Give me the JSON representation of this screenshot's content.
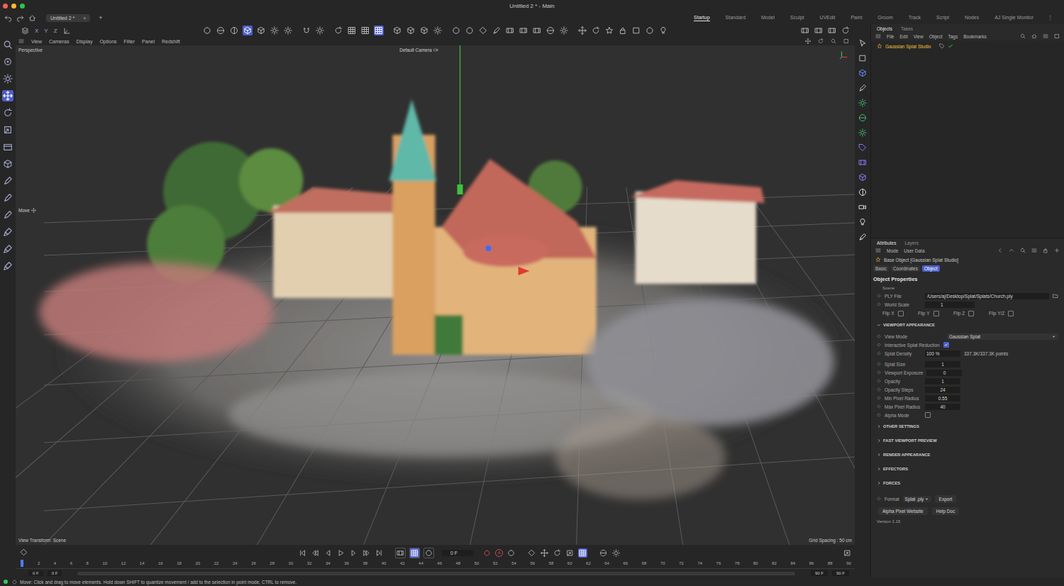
{
  "window": {
    "title": "Untitled 2 * - Main"
  },
  "document_tabs": [
    {
      "label": "Untitled 2 *",
      "selected": true,
      "close": "×"
    }
  ],
  "new_tab": "+",
  "layouts": [
    {
      "label": "Startup",
      "selected": true
    },
    {
      "label": "Standard",
      "selected": false
    },
    {
      "label": "Model",
      "selected": false
    },
    {
      "label": "Sculpt",
      "selected": false
    },
    {
      "label": "UVEdit",
      "selected": false
    },
    {
      "label": "Paint",
      "selected": false
    },
    {
      "label": "Groom",
      "selected": false
    },
    {
      "label": "Track",
      "selected": false
    },
    {
      "label": "Script",
      "selected": false
    },
    {
      "label": "Nodes",
      "selected": false
    },
    {
      "label": "AJ Single Monitor",
      "selected": false
    }
  ],
  "layouts_more": "⋮",
  "left_tools": [
    {
      "selected": false
    },
    {
      "selected": false
    },
    {
      "selected": false
    },
    {
      "selected": true
    },
    {
      "selected": false
    },
    {
      "selected": false
    },
    {
      "selected": false
    },
    {
      "selected": false
    },
    {
      "selected": false
    },
    {
      "selected": false
    },
    {
      "selected": false
    },
    {
      "selected": false
    },
    {
      "selected": false
    },
    {
      "selected": false
    }
  ],
  "viewport_toolbar": {
    "axis_locks": [
      "X",
      "Y",
      "Z"
    ],
    "groups": [
      [
        {
          "selected": false
        },
        {
          "selected": false
        },
        {
          "selected": false
        },
        {
          "selected": true
        },
        {
          "selected": false
        },
        {
          "selected": false
        },
        {
          "selected": false
        }
      ],
      [
        {
          "selected": false
        },
        {
          "selected": false
        }
      ],
      [
        {
          "selected": false
        },
        {
          "selected": false
        },
        {
          "selected": false
        },
        {
          "selected": true
        }
      ],
      [
        {
          "selected": false
        },
        {
          "selected": false
        },
        {
          "selected": false
        },
        {
          "selected": false
        }
      ],
      [
        {
          "selected": false
        },
        {
          "selected": false
        },
        {
          "selected": false
        },
        {
          "selected": false
        },
        {
          "selected": false
        },
        {
          "selected": false
        },
        {
          "selected": false
        },
        {
          "selected": false
        },
        {
          "selected": false
        }
      ],
      [
        {
          "selected": false
        },
        {
          "selected": false
        },
        {
          "selected": false
        },
        {
          "selected": false
        },
        {
          "selected": false
        },
        {
          "selected": false
        },
        {
          "selected": false
        }
      ]
    ],
    "right": [
      {
        "selected": false
      },
      {
        "selected": false
      },
      {
        "selected": false
      },
      {
        "selected": false
      }
    ]
  },
  "viewport": {
    "menu": [
      "View",
      "Cameras",
      "Display",
      "Options",
      "Filter",
      "Panel",
      "Redshift"
    ],
    "view_name": "Perspective",
    "camera": "Default Camera",
    "tool_hint": "Move",
    "view_transform": "View Transform: Scene",
    "grid_spacing": "Grid Spacing : 50 cm"
  },
  "timeline": {
    "current_frame": "0 F",
    "autokey": "A",
    "mode_buttons": [
      {
        "selected": false
      },
      {
        "selected": true
      },
      {
        "selected": false
      }
    ],
    "key_buttons": [
      {
        "selected": false
      },
      {
        "selected": false
      },
      {
        "selected": false
      },
      {
        "selected": false
      },
      {
        "selected": true
      }
    ],
    "ticks": [
      "0",
      "2",
      "4",
      "6",
      "8",
      "10",
      "12",
      "14",
      "16",
      "18",
      "20",
      "22",
      "24",
      "26",
      "28",
      "30",
      "32",
      "34",
      "36",
      "38",
      "40",
      "42",
      "44",
      "46",
      "48",
      "50",
      "52",
      "54",
      "56",
      "58",
      "60",
      "62",
      "64",
      "66",
      "68",
      "70",
      "72",
      "74",
      "76",
      "78",
      "80",
      "82",
      "84",
      "86",
      "88",
      "90"
    ],
    "playhead_level": 0,
    "range_start": "0 F",
    "preview_start": "0 F",
    "preview_end": "90 F",
    "range_end": "90 F"
  },
  "objects_manager": {
    "tabs": [
      {
        "label": "Objects",
        "selected": true
      },
      {
        "label": "Takes",
        "selected": false
      }
    ],
    "menu": [
      "File",
      "Edit",
      "View",
      "Object",
      "Tags",
      "Bookmarks"
    ],
    "items": [
      {
        "name": "Gaussian Splat Studio",
        "selected": true,
        "enabled": true
      }
    ]
  },
  "attributes": {
    "tabs": [
      {
        "label": "Attributes",
        "selected": true
      },
      {
        "label": "Layers",
        "selected": false
      }
    ],
    "menu": [
      "Mode",
      "User Data"
    ],
    "object_title": "Base Object [Gaussian Splat Studio]",
    "sub_tabs": [
      {
        "label": "Basic",
        "selected": false
      },
      {
        "label": "Coordinates",
        "selected": false
      },
      {
        "label": "Object",
        "selected": true
      }
    ],
    "heading": "Object Properties",
    "group": "Scene",
    "ply_file": {
      "label": "PLY File",
      "value": "/Users/aj/Desktop/Splat/Splats/Church.ply"
    },
    "world_scale": {
      "label": "World Scale",
      "value": "1"
    },
    "flips": [
      {
        "label": "Flip X",
        "checked": false
      },
      {
        "label": "Flip Y",
        "checked": false
      },
      {
        "label": "Flip Z",
        "checked": false
      },
      {
        "label": "Flip Y/Z",
        "checked": false
      }
    ],
    "sections": [
      {
        "title": "VIEWPORT APPEARANCE",
        "expanded": true,
        "rows": [
          {
            "kind": "dropdown",
            "label": "View Mode",
            "value": "Gaussian Splat"
          },
          {
            "kind": "checkbox",
            "label": "Interactive Splat Reduction",
            "checked": true
          },
          {
            "kind": "density",
            "label": "Splat Density",
            "value": "100 %",
            "note": "337.3K/337.3K points"
          },
          {
            "kind": "field",
            "label": "Splat Size",
            "value": "1"
          },
          {
            "kind": "field",
            "label": "Viewport Exposure",
            "value": "0"
          },
          {
            "kind": "field",
            "label": "Opacity",
            "value": "1"
          },
          {
            "kind": "field",
            "label": "Opacity Steps",
            "value": "24"
          },
          {
            "kind": "field",
            "label": "Min Pixel Radius",
            "value": "0.55"
          },
          {
            "kind": "field",
            "label": "Max Pixel Radius",
            "value": "40"
          },
          {
            "kind": "checkbox",
            "label": "Alpha Mode",
            "checked": false
          }
        ]
      },
      {
        "title": "OTHER SETTINGS",
        "expanded": false,
        "rows": []
      },
      {
        "title": "FAST VIEWPORT PREVIEW",
        "expanded": false,
        "rows": []
      },
      {
        "title": "RENDER APPEARANCE",
        "expanded": false,
        "rows": []
      },
      {
        "title": "EFFECTORS",
        "expanded": false,
        "rows": []
      },
      {
        "title": "FORCES",
        "expanded": false,
        "rows": []
      }
    ],
    "format": {
      "label": "Format",
      "value": "Splat .ply",
      "button": "Export"
    },
    "links": [
      "Alpha Pixel Website",
      "Help Doc"
    ],
    "version": "Version 1.15"
  },
  "status_bar": {
    "message": "Move: Click and drag to move elements. Hold down SHIFT to quantize movement / add to the selection in point mode, CTRL to remove."
  }
}
